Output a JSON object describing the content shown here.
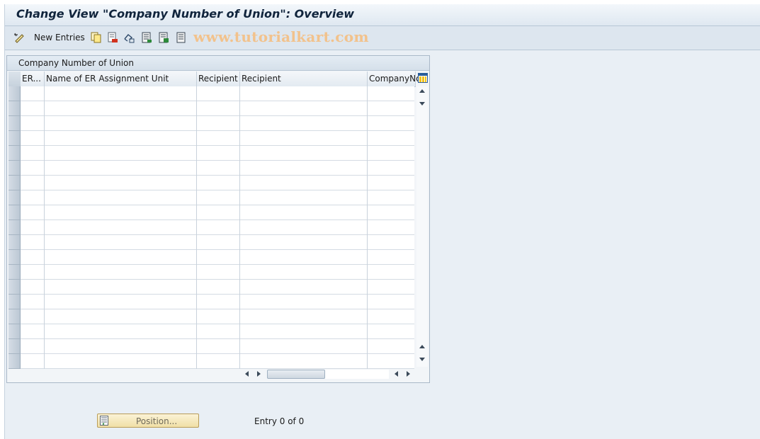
{
  "window": {
    "title": "Change View \"Company Number of Union\": Overview"
  },
  "toolbar": {
    "new_entries_label": "New Entries",
    "watermark": "www.tutorialkart.com",
    "icons": [
      "display-change-icon",
      "copy-icon",
      "delete-icon",
      "undo-icon",
      "select-all-icon",
      "select-block-icon",
      "deselect-all-icon"
    ]
  },
  "table": {
    "caption": "Company Number of Union",
    "columns": [
      "ER...",
      "Name of ER Assignment Unit",
      "Recipient",
      "Recipient",
      "CompanyNo"
    ],
    "rows": [
      [],
      [],
      [],
      [],
      [],
      [],
      [],
      [],
      [],
      [],
      [],
      [],
      [],
      [],
      [],
      [],
      [],
      [],
      []
    ]
  },
  "footer": {
    "position_button_label": "Position...",
    "entry_status": "Entry 0 of 0"
  },
  "colors": {
    "title_text": "#10243c",
    "watermark": "#f2c28c",
    "position_button": "#f0dfa6"
  }
}
